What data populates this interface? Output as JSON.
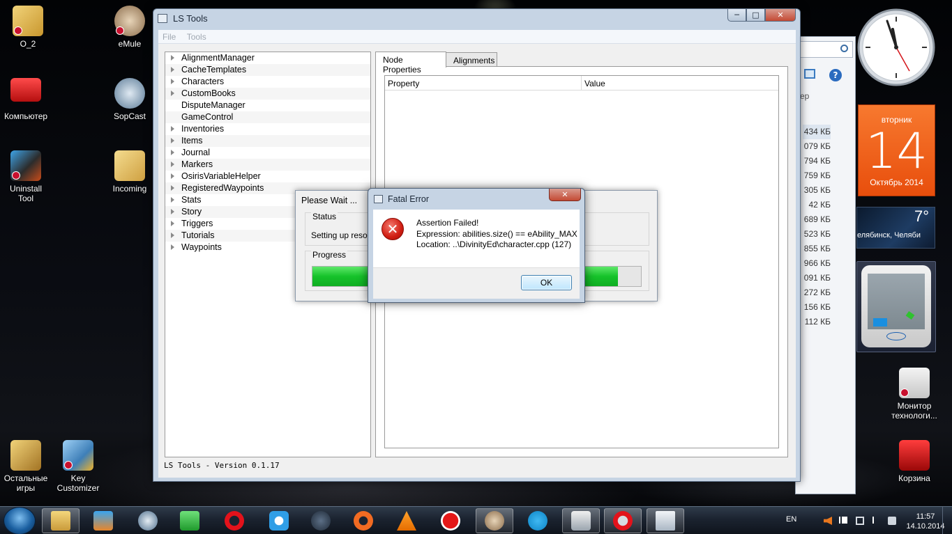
{
  "desktop": {
    "icons": [
      {
        "label": "O_2"
      },
      {
        "label": "eMule"
      },
      {
        "label": "Компьютер"
      },
      {
        "label": "SopCast"
      },
      {
        "label": "Uninstall Tool"
      },
      {
        "label": "Incoming"
      },
      {
        "label": "Остальные игры"
      },
      {
        "label": "Key Customizer"
      },
      {
        "label": "Монитор технологи..."
      },
      {
        "label": "Корзина"
      }
    ]
  },
  "explorer": {
    "column_header": "ер",
    "sizes": [
      "434 КБ",
      "079 КБ",
      "794 КБ",
      "759 КБ",
      "305 КБ",
      "42 КБ",
      "689 КБ",
      "523 КБ",
      "855 КБ",
      "966 КБ",
      "091 КБ",
      "272 КБ",
      "156 КБ",
      "112 КБ"
    ]
  },
  "window": {
    "title": "LS Tools",
    "menu": [
      "File",
      "Tools"
    ],
    "tree_items": [
      {
        "label": "AlignmentManager",
        "expandable": true
      },
      {
        "label": "CacheTemplates",
        "expandable": true
      },
      {
        "label": "Characters",
        "expandable": true
      },
      {
        "label": "CustomBooks",
        "expandable": true
      },
      {
        "label": "DisputeManager",
        "expandable": false
      },
      {
        "label": "GameControl",
        "expandable": false
      },
      {
        "label": "Inventories",
        "expandable": true
      },
      {
        "label": "Items",
        "expandable": true
      },
      {
        "label": "Journal",
        "expandable": true
      },
      {
        "label": "Markers",
        "expandable": true
      },
      {
        "label": "OsirisVariableHelper",
        "expandable": true
      },
      {
        "label": "RegisteredWaypoints",
        "expandable": true
      },
      {
        "label": "Stats",
        "expandable": true
      },
      {
        "label": "Story",
        "expandable": true
      },
      {
        "label": "Triggers",
        "expandable": true
      },
      {
        "label": "Tutorials",
        "expandable": true
      },
      {
        "label": "Waypoints",
        "expandable": true
      }
    ],
    "tabs": [
      {
        "label": "Node Properties",
        "active": true
      },
      {
        "label": "Alignments",
        "active": false
      }
    ],
    "columns": {
      "property": "Property",
      "value": "Value"
    },
    "status": "LS Tools - Version 0.1.17"
  },
  "wait_dialog": {
    "title": "Please Wait ...",
    "status_label": "Status",
    "status_text": "Setting up resources",
    "progress_label": "Progress",
    "progress_fraction": 0.93
  },
  "error_dialog": {
    "title": "Fatal Error",
    "line1": "Assertion Failed!",
    "line2": "Expression: abilities.size() == eAbility_MAX",
    "line3": "Location: ..\\DivinityEd\\character.cpp (127)",
    "ok_label": "OK"
  },
  "gadgets": {
    "calendar": {
      "weekday": "вторник",
      "day": "14",
      "month": "Октябрь 2014"
    },
    "weather": {
      "temp": "7°",
      "city": "елябинск, Челяби"
    }
  },
  "taskbar": {
    "language": "EN",
    "time": "11:57",
    "date": "14.10.2014"
  },
  "colors": {
    "progress": "#16c22a",
    "calendar": "#f36a20",
    "error": "#d01d12"
  }
}
